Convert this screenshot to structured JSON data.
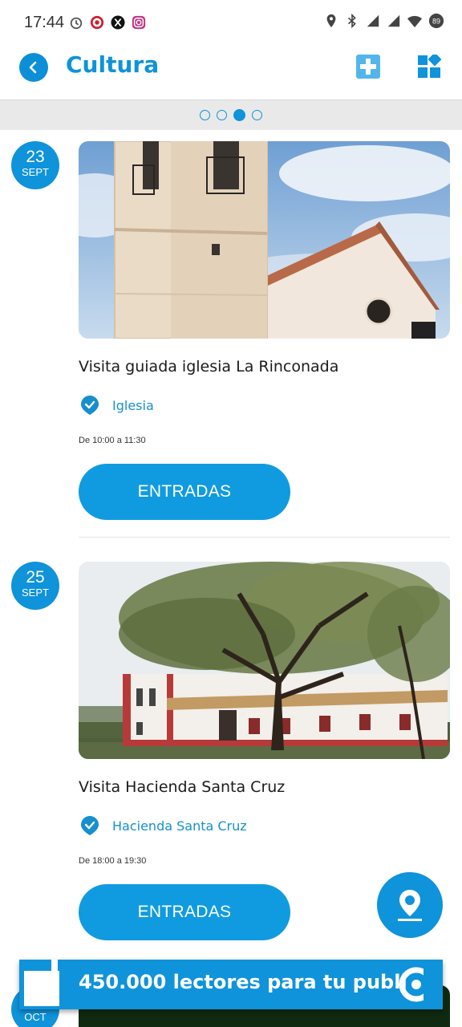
{
  "status_bar": {
    "time": "17:44",
    "left_icons": [
      "alarm-icon",
      "target-icon",
      "x-icon",
      "instagram-icon"
    ],
    "right_icons": [
      "location-icon",
      "bluetooth-icon",
      "signal-icon",
      "signal-icon",
      "wifi-icon",
      "battery-icon"
    ],
    "battery": "89"
  },
  "app_bar": {
    "title": "Cultura"
  },
  "pager": {
    "pages": 4,
    "active_index": 2
  },
  "events": [
    {
      "day": "23",
      "month": "SEPT",
      "title": "Visita guiada iglesia La Rinconada",
      "venue": "Iglesia",
      "time": "De 10:00 a 11:30",
      "button": "ENTRADAS"
    },
    {
      "day": "25",
      "month": "SEPT",
      "title": "Visita Hacienda Santa Cruz",
      "venue": "Hacienda Santa Cruz",
      "time": "De 18:00 a 19:30",
      "button": "ENTRADAS"
    }
  ],
  "next_event": {
    "month": "OCT"
  },
  "ad": {
    "text": "450.000 lectores para tu publi"
  },
  "colors": {
    "primary": "#0f93da",
    "button": "#109be0"
  }
}
